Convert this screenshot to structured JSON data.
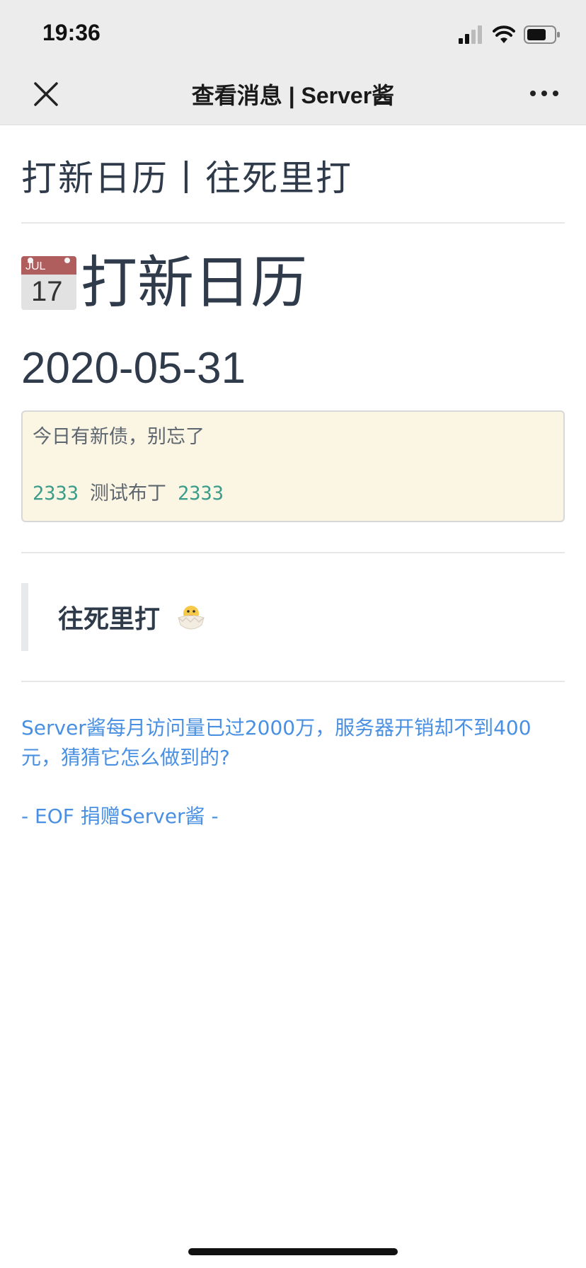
{
  "status_bar": {
    "time": "19:36",
    "icons": [
      "signal-icon",
      "wifi-icon",
      "battery-icon"
    ]
  },
  "nav": {
    "title": "查看消息 | Server酱",
    "close_icon": "close-icon",
    "more_icon": "more-icon"
  },
  "message": {
    "subject": "打新日历丨往死里打",
    "calendar_icon": {
      "month": "JUL",
      "day": "17"
    },
    "heading": "打新日历",
    "date": "2020-05-31",
    "notice": {
      "line1": "今日有新债，别忘了",
      "code_left": "2333",
      "name": "测试布丁",
      "code_right": "2333"
    },
    "quote": {
      "text": "往死里打",
      "icon": "hatching-chick-icon"
    },
    "promo_text": "Server酱每月访问量已过2000万，服务器开销却不到400元，猜猜它怎么做到的?",
    "eof_text": "- EOF 捐赠Server酱 -"
  },
  "colors": {
    "link": "#4a90e2",
    "code": "#3b9c8a",
    "notice_bg": "#fbf5e3",
    "text": "#2f3b4b",
    "bar_bg": "#ececec"
  }
}
